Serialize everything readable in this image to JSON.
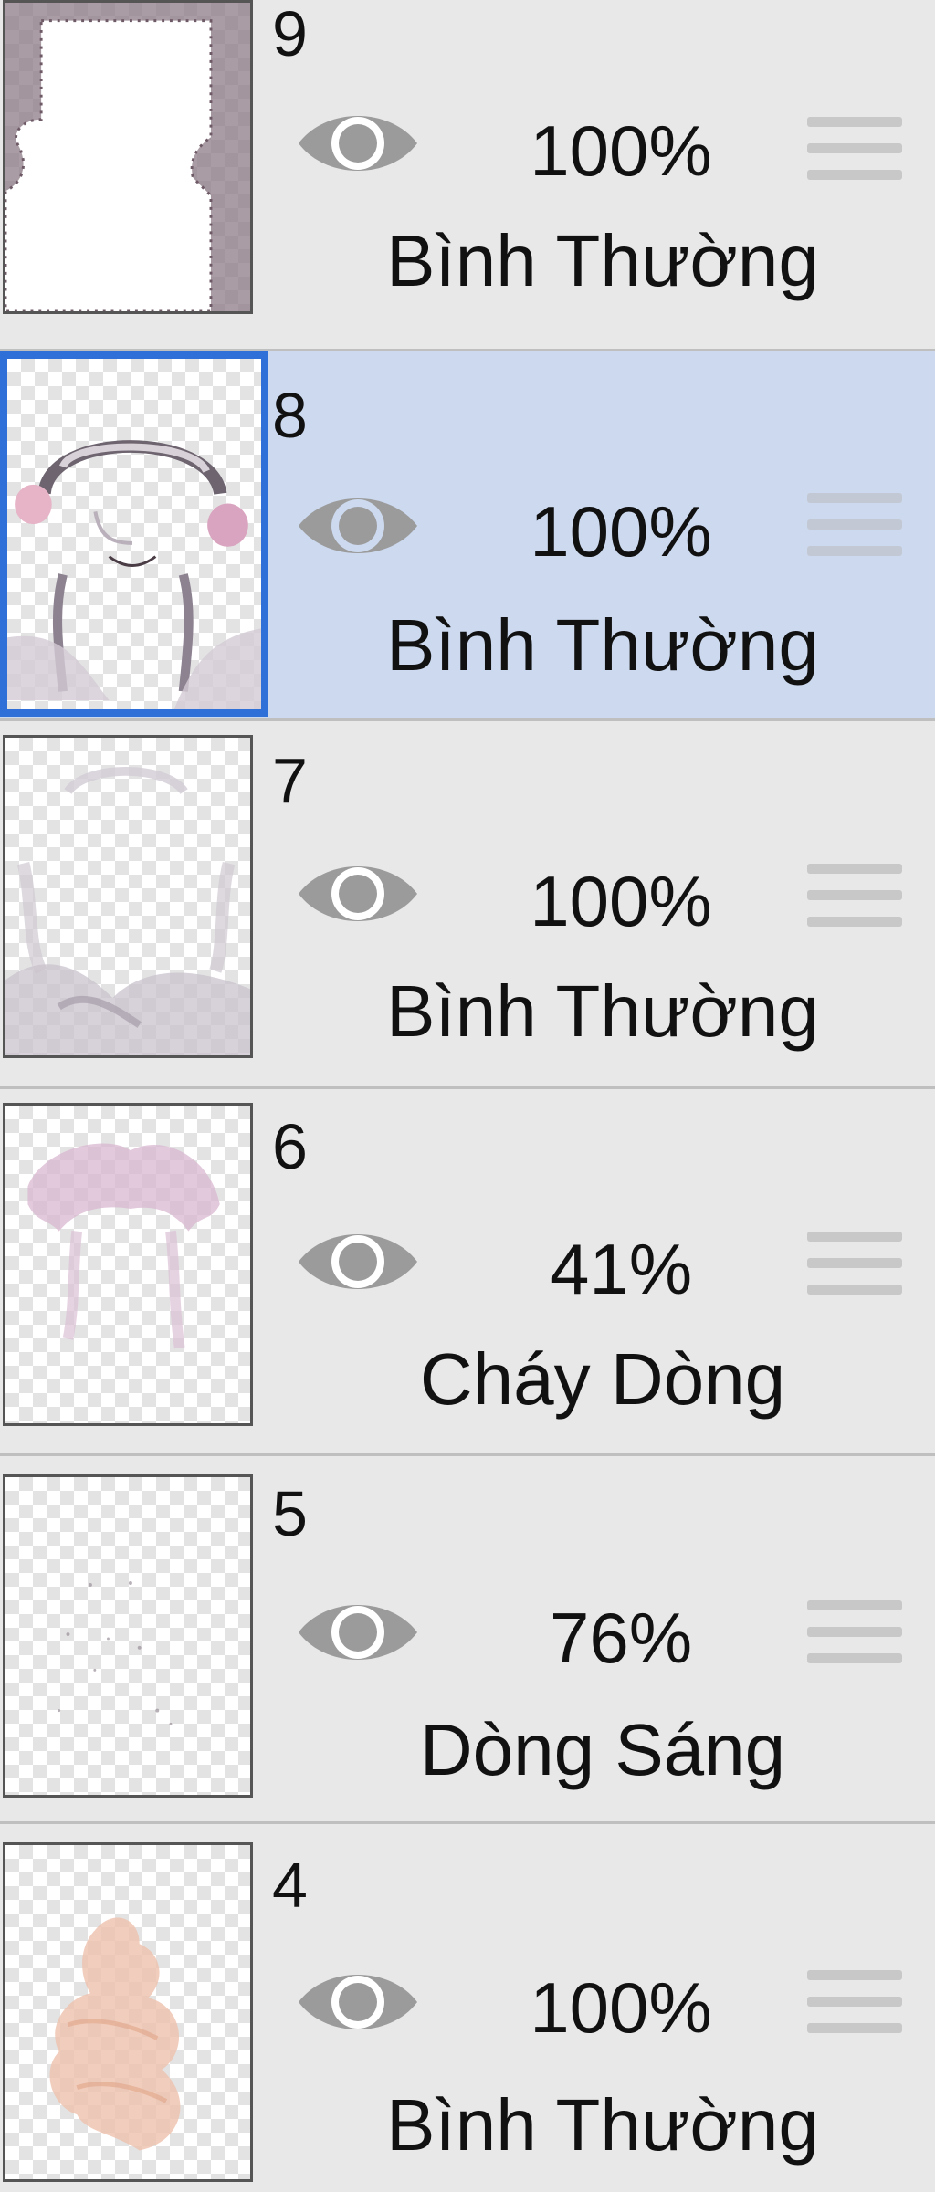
{
  "layers": [
    {
      "number": "9",
      "opacity": "100%",
      "blend_mode": "Bình Thường",
      "visible": true,
      "selected": false
    },
    {
      "number": "8",
      "opacity": "100%",
      "blend_mode": "Bình Thường",
      "visible": true,
      "selected": true
    },
    {
      "number": "7",
      "opacity": "100%",
      "blend_mode": "Bình Thường",
      "visible": true,
      "selected": false
    },
    {
      "number": "6",
      "opacity": "41%",
      "blend_mode": "Cháy Dòng",
      "visible": true,
      "selected": false
    },
    {
      "number": "5",
      "opacity": "76%",
      "blend_mode": "Dòng Sáng",
      "visible": true,
      "selected": false
    },
    {
      "number": "4",
      "opacity": "100%",
      "blend_mode": "Bình Thường",
      "visible": true,
      "selected": false
    }
  ],
  "icons": {
    "visibility": "eye-icon",
    "reorder": "drag-handle-icon"
  },
  "colors": {
    "selected_background": "#ccd9ee",
    "selected_border": "#2f6fd8",
    "row_background": "#e8e8e8",
    "icon_gray": "#9b9b9b"
  }
}
